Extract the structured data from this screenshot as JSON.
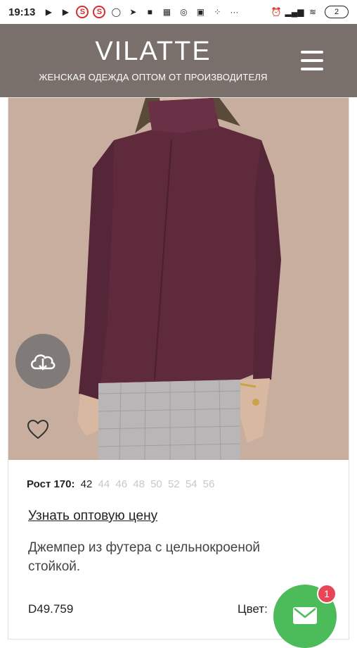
{
  "status_bar": {
    "time": "19:13",
    "battery": "2"
  },
  "header": {
    "brand": "VILATTE",
    "tagline": "ЖЕНСКАЯ ОДЕЖДА ОПТОМ ОТ ПРОИЗВОДИТЕЛЯ",
    "background_color": "#7a706b"
  },
  "product": {
    "height_label": "Рост 170:",
    "sizes": [
      {
        "label": "42",
        "available": true
      },
      {
        "label": "44",
        "available": false
      },
      {
        "label": "46",
        "available": false
      },
      {
        "label": "48",
        "available": false
      },
      {
        "label": "50",
        "available": false
      },
      {
        "label": "52",
        "available": false
      },
      {
        "label": "54",
        "available": false
      },
      {
        "label": "56",
        "available": false
      }
    ],
    "wholesale_link": "Узнать оптовую цену",
    "description": "Джемпер из футера с цельнокроеной стойкой.",
    "sku": "D49.759",
    "color_label": "Цвет:"
  },
  "icons": {
    "download": "cloud-download-icon",
    "favorite": "heart-icon",
    "mail": "mail-icon",
    "menu": "hamburger-menu-icon"
  },
  "mail_fab": {
    "badge_count": "1",
    "color": "#4cbb5a",
    "badge_color": "#e84557"
  }
}
